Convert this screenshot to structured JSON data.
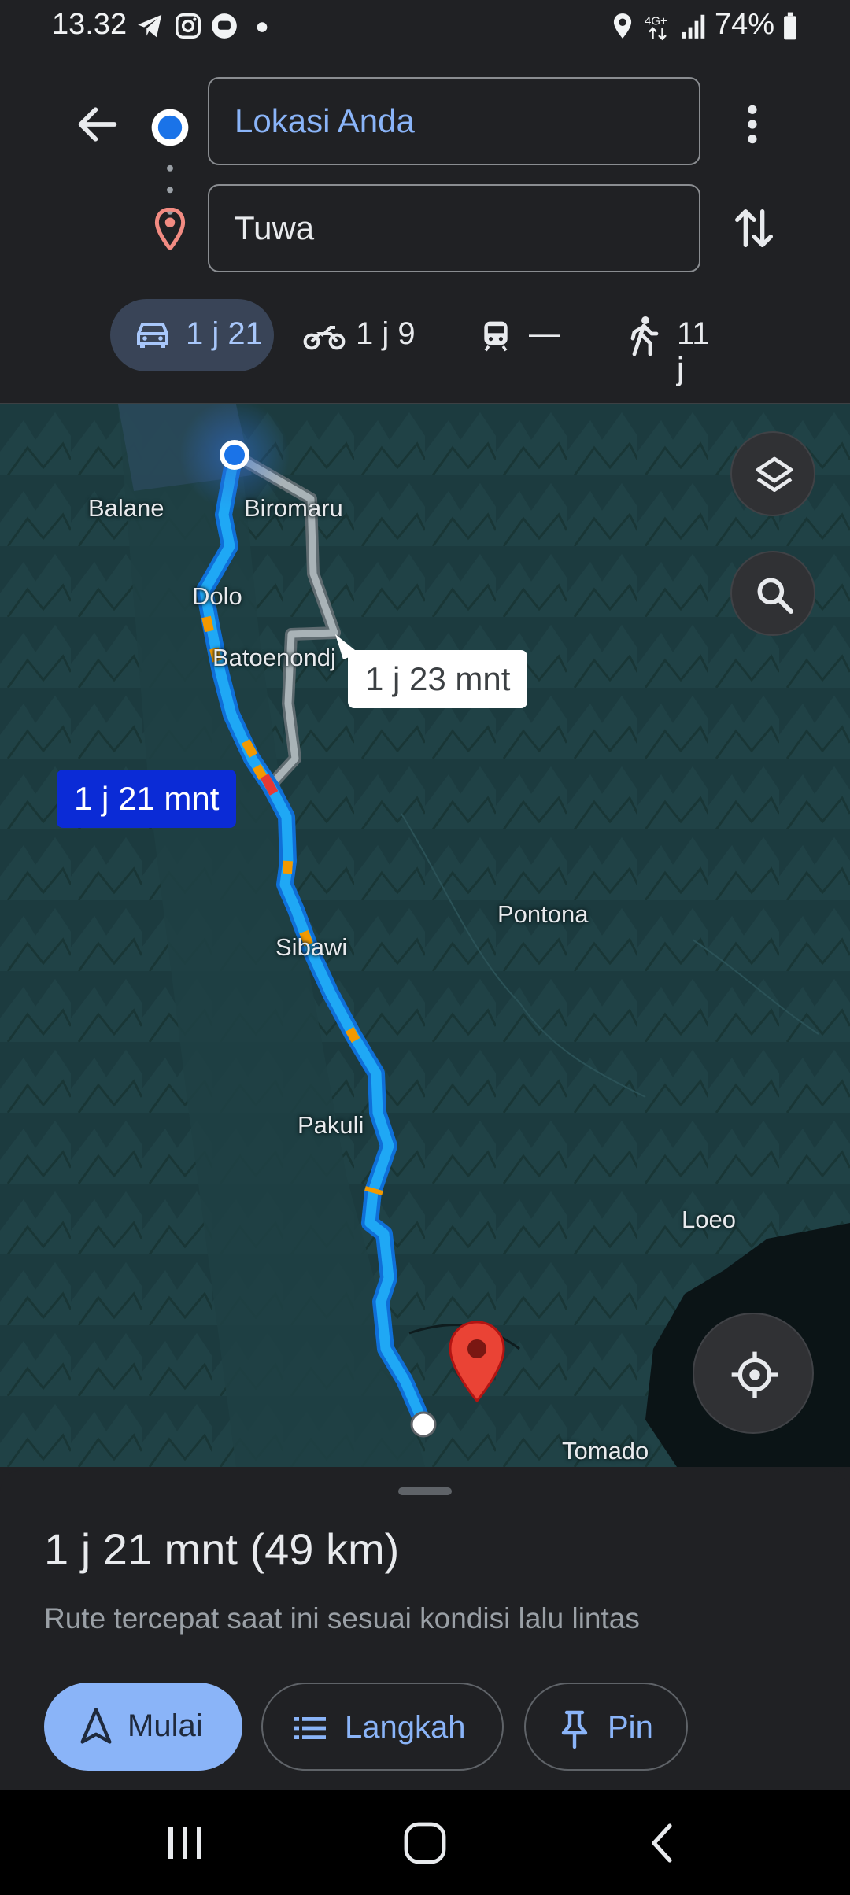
{
  "status_bar": {
    "time": "13.32",
    "battery": "74%",
    "notification_icons": [
      "telegram-icon",
      "instagram-icon",
      "chat-icon",
      "dot-icon"
    ],
    "system_icons": [
      "location-icon",
      "4g-data-icon",
      "signal-icon",
      "battery-icon"
    ]
  },
  "directions": {
    "origin": "Lokasi Anda",
    "destination": "Tuwa"
  },
  "modes": [
    {
      "id": "car",
      "icon": "car-icon",
      "label": "1 j 21",
      "selected": true
    },
    {
      "id": "motorcycle",
      "icon": "motorcycle-icon",
      "label": "1 j 9",
      "selected": false
    },
    {
      "id": "transit",
      "icon": "train-icon",
      "label": "—",
      "selected": false
    },
    {
      "id": "walk",
      "icon": "walk-icon",
      "label": "11 j",
      "selected": false
    }
  ],
  "map": {
    "places": [
      "Balane",
      "Biromaru",
      "Dolo",
      "Batoenondj",
      "Pontona",
      "Sibawi",
      "Pakuli",
      "Loeo",
      "Tomado"
    ],
    "route_main_label": "1 j 21 mnt",
    "route_alt_label": "1 j 23 mnt",
    "colors": {
      "route": "#1fa8f5",
      "route_border": "#0f6fd8",
      "alt_route": "#9aa6ab",
      "traffic_slow": "#f29900",
      "traffic_heavy": "#e53935",
      "pin": "#ea4335"
    }
  },
  "sheet": {
    "summary": "1 j 21 mnt (49 km)",
    "note": "Rute tercepat saat ini sesuai kondisi lalu lintas",
    "buttons": {
      "start": "Mulai",
      "steps": "Langkah",
      "pin": "Pin"
    }
  }
}
